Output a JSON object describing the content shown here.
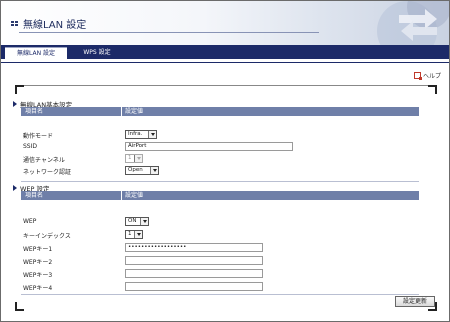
{
  "header": {
    "title": "無線LAN 設定"
  },
  "tabs": [
    {
      "label": "無線LAN 設定",
      "active": true
    },
    {
      "label": "WPS 設定",
      "active": false
    }
  ],
  "help": {
    "label": "ヘルプ"
  },
  "basic": {
    "title": "無線LAN基本設定",
    "col_item": "項目名",
    "col_value": "設定値",
    "rows": {
      "mode": {
        "label": "動作モード",
        "value": "Infra."
      },
      "ssid": {
        "label": "SSID",
        "value": "AirPort"
      },
      "channel": {
        "label": "通信チャンネル",
        "value": "1"
      },
      "auth": {
        "label": "ネットワーク認証",
        "value": "Open"
      }
    }
  },
  "wep": {
    "title": "WEP 設定",
    "col_item": "項目名",
    "col_value": "設定値",
    "rows": {
      "wep": {
        "label": "WEP",
        "value": "ON"
      },
      "key_index": {
        "label": "キーインデックス",
        "value": "1"
      },
      "key1": {
        "label": "WEPキー1",
        "value": "••••••••••••••••••"
      },
      "key2": {
        "label": "WEPキー2",
        "value": ""
      },
      "key3": {
        "label": "WEPキー3",
        "value": ""
      },
      "key4": {
        "label": "WEPキー4",
        "value": ""
      }
    }
  },
  "submit": {
    "label": "設定更新"
  },
  "colors": {
    "navy": "#1c2a68",
    "table_header": "#6f7fa8"
  }
}
